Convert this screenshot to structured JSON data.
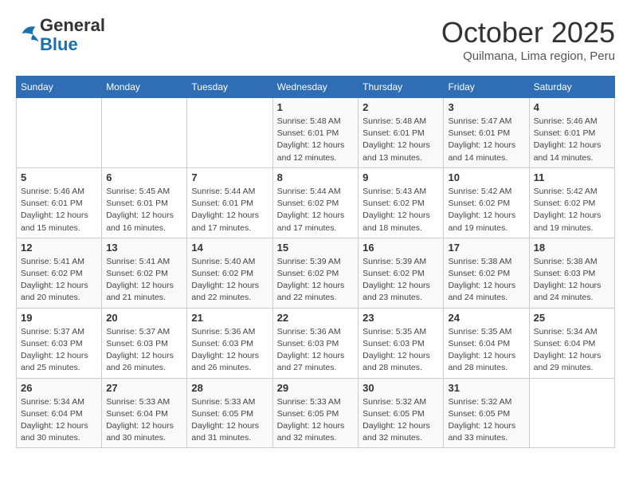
{
  "header": {
    "logo_line1": "General",
    "logo_line2": "Blue",
    "month_title": "October 2025",
    "location": "Quilmana, Lima region, Peru"
  },
  "weekdays": [
    "Sunday",
    "Monday",
    "Tuesday",
    "Wednesday",
    "Thursday",
    "Friday",
    "Saturday"
  ],
  "weeks": [
    [
      {
        "day": "",
        "sunrise": "",
        "sunset": "",
        "daylight": ""
      },
      {
        "day": "",
        "sunrise": "",
        "sunset": "",
        "daylight": ""
      },
      {
        "day": "",
        "sunrise": "",
        "sunset": "",
        "daylight": ""
      },
      {
        "day": "1",
        "sunrise": "Sunrise: 5:48 AM",
        "sunset": "Sunset: 6:01 PM",
        "daylight": "Daylight: 12 hours and 12 minutes."
      },
      {
        "day": "2",
        "sunrise": "Sunrise: 5:48 AM",
        "sunset": "Sunset: 6:01 PM",
        "daylight": "Daylight: 12 hours and 13 minutes."
      },
      {
        "day": "3",
        "sunrise": "Sunrise: 5:47 AM",
        "sunset": "Sunset: 6:01 PM",
        "daylight": "Daylight: 12 hours and 14 minutes."
      },
      {
        "day": "4",
        "sunrise": "Sunrise: 5:46 AM",
        "sunset": "Sunset: 6:01 PM",
        "daylight": "Daylight: 12 hours and 14 minutes."
      }
    ],
    [
      {
        "day": "5",
        "sunrise": "Sunrise: 5:46 AM",
        "sunset": "Sunset: 6:01 PM",
        "daylight": "Daylight: 12 hours and 15 minutes."
      },
      {
        "day": "6",
        "sunrise": "Sunrise: 5:45 AM",
        "sunset": "Sunset: 6:01 PM",
        "daylight": "Daylight: 12 hours and 16 minutes."
      },
      {
        "day": "7",
        "sunrise": "Sunrise: 5:44 AM",
        "sunset": "Sunset: 6:01 PM",
        "daylight": "Daylight: 12 hours and 17 minutes."
      },
      {
        "day": "8",
        "sunrise": "Sunrise: 5:44 AM",
        "sunset": "Sunset: 6:02 PM",
        "daylight": "Daylight: 12 hours and 17 minutes."
      },
      {
        "day": "9",
        "sunrise": "Sunrise: 5:43 AM",
        "sunset": "Sunset: 6:02 PM",
        "daylight": "Daylight: 12 hours and 18 minutes."
      },
      {
        "day": "10",
        "sunrise": "Sunrise: 5:42 AM",
        "sunset": "Sunset: 6:02 PM",
        "daylight": "Daylight: 12 hours and 19 minutes."
      },
      {
        "day": "11",
        "sunrise": "Sunrise: 5:42 AM",
        "sunset": "Sunset: 6:02 PM",
        "daylight": "Daylight: 12 hours and 19 minutes."
      }
    ],
    [
      {
        "day": "12",
        "sunrise": "Sunrise: 5:41 AM",
        "sunset": "Sunset: 6:02 PM",
        "daylight": "Daylight: 12 hours and 20 minutes."
      },
      {
        "day": "13",
        "sunrise": "Sunrise: 5:41 AM",
        "sunset": "Sunset: 6:02 PM",
        "daylight": "Daylight: 12 hours and 21 minutes."
      },
      {
        "day": "14",
        "sunrise": "Sunrise: 5:40 AM",
        "sunset": "Sunset: 6:02 PM",
        "daylight": "Daylight: 12 hours and 22 minutes."
      },
      {
        "day": "15",
        "sunrise": "Sunrise: 5:39 AM",
        "sunset": "Sunset: 6:02 PM",
        "daylight": "Daylight: 12 hours and 22 minutes."
      },
      {
        "day": "16",
        "sunrise": "Sunrise: 5:39 AM",
        "sunset": "Sunset: 6:02 PM",
        "daylight": "Daylight: 12 hours and 23 minutes."
      },
      {
        "day": "17",
        "sunrise": "Sunrise: 5:38 AM",
        "sunset": "Sunset: 6:02 PM",
        "daylight": "Daylight: 12 hours and 24 minutes."
      },
      {
        "day": "18",
        "sunrise": "Sunrise: 5:38 AM",
        "sunset": "Sunset: 6:03 PM",
        "daylight": "Daylight: 12 hours and 24 minutes."
      }
    ],
    [
      {
        "day": "19",
        "sunrise": "Sunrise: 5:37 AM",
        "sunset": "Sunset: 6:03 PM",
        "daylight": "Daylight: 12 hours and 25 minutes."
      },
      {
        "day": "20",
        "sunrise": "Sunrise: 5:37 AM",
        "sunset": "Sunset: 6:03 PM",
        "daylight": "Daylight: 12 hours and 26 minutes."
      },
      {
        "day": "21",
        "sunrise": "Sunrise: 5:36 AM",
        "sunset": "Sunset: 6:03 PM",
        "daylight": "Daylight: 12 hours and 26 minutes."
      },
      {
        "day": "22",
        "sunrise": "Sunrise: 5:36 AM",
        "sunset": "Sunset: 6:03 PM",
        "daylight": "Daylight: 12 hours and 27 minutes."
      },
      {
        "day": "23",
        "sunrise": "Sunrise: 5:35 AM",
        "sunset": "Sunset: 6:03 PM",
        "daylight": "Daylight: 12 hours and 28 minutes."
      },
      {
        "day": "24",
        "sunrise": "Sunrise: 5:35 AM",
        "sunset": "Sunset: 6:04 PM",
        "daylight": "Daylight: 12 hours and 28 minutes."
      },
      {
        "day": "25",
        "sunrise": "Sunrise: 5:34 AM",
        "sunset": "Sunset: 6:04 PM",
        "daylight": "Daylight: 12 hours and 29 minutes."
      }
    ],
    [
      {
        "day": "26",
        "sunrise": "Sunrise: 5:34 AM",
        "sunset": "Sunset: 6:04 PM",
        "daylight": "Daylight: 12 hours and 30 minutes."
      },
      {
        "day": "27",
        "sunrise": "Sunrise: 5:33 AM",
        "sunset": "Sunset: 6:04 PM",
        "daylight": "Daylight: 12 hours and 30 minutes."
      },
      {
        "day": "28",
        "sunrise": "Sunrise: 5:33 AM",
        "sunset": "Sunset: 6:05 PM",
        "daylight": "Daylight: 12 hours and 31 minutes."
      },
      {
        "day": "29",
        "sunrise": "Sunrise: 5:33 AM",
        "sunset": "Sunset: 6:05 PM",
        "daylight": "Daylight: 12 hours and 32 minutes."
      },
      {
        "day": "30",
        "sunrise": "Sunrise: 5:32 AM",
        "sunset": "Sunset: 6:05 PM",
        "daylight": "Daylight: 12 hours and 32 minutes."
      },
      {
        "day": "31",
        "sunrise": "Sunrise: 5:32 AM",
        "sunset": "Sunset: 6:05 PM",
        "daylight": "Daylight: 12 hours and 33 minutes."
      },
      {
        "day": "",
        "sunrise": "",
        "sunset": "",
        "daylight": ""
      }
    ]
  ]
}
